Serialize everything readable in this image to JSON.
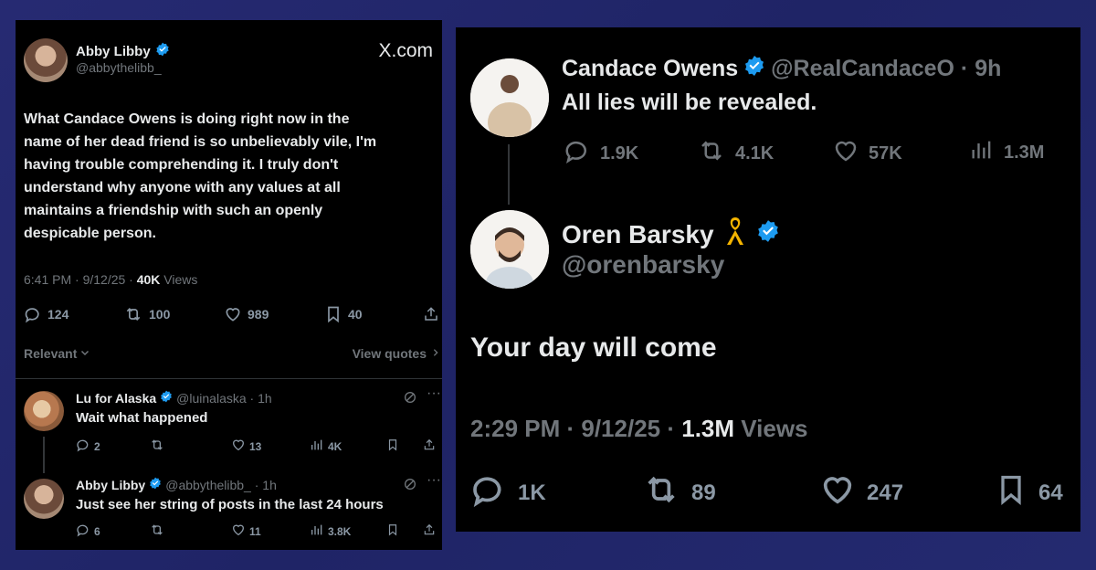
{
  "left_tweet": {
    "author_name": "Abby Libby",
    "handle": "@abbythelibb_",
    "brand": "X.com",
    "body_lines": [
      "What Candace Owens is doing right now in the",
      "name of her dead friend is so unbelievably vile, I'm",
      "having trouble comprehending it. I truly don't",
      "understand why anyone with any values at all",
      "maintains a friendship with such an openly",
      "despicable person."
    ],
    "timestamp": "6:41 PM · 9/12/25 · ",
    "views_count": "40K",
    "views_label": " Views",
    "replies": "124",
    "reposts": "100",
    "likes": "989",
    "bookmarks": "40",
    "sort_label": "Relevant",
    "view_quotes": "View quotes"
  },
  "left_replies": [
    {
      "author_name": "Lu for Alaska",
      "handle_time": "@luinalaska · 1h",
      "text": "Wait what happened",
      "replies": "2",
      "likes": "13",
      "views": "4K"
    },
    {
      "author_name": "Abby Libby",
      "handle_time": "@abbythelibb_ · 1h",
      "text": "Just see her string of posts in the last 24 hours",
      "replies": "6",
      "likes": "11",
      "views": "3.8K"
    }
  ],
  "right_parent": {
    "author_name": "Candace Owens",
    "handle_time": "@RealCandaceO · 9h",
    "text": "All lies will be revealed.",
    "replies": "1.9K",
    "reposts": "4.1K",
    "likes": "57K",
    "views": "1.3M"
  },
  "right_reply": {
    "author_name": "Oren Barsky",
    "handle": "@orenbarsky",
    "text": "Your day will come",
    "timestamp": "2:29 PM · 9/12/25 · ",
    "views_count": "1.3M",
    "views_label": " Views",
    "replies": "1K",
    "reposts": "89",
    "likes": "247",
    "bookmarks": "64"
  },
  "colors": {
    "background": "#232870",
    "panel": "#000000",
    "verified": "#1d9bf0",
    "ribbon": "#f4b400"
  }
}
